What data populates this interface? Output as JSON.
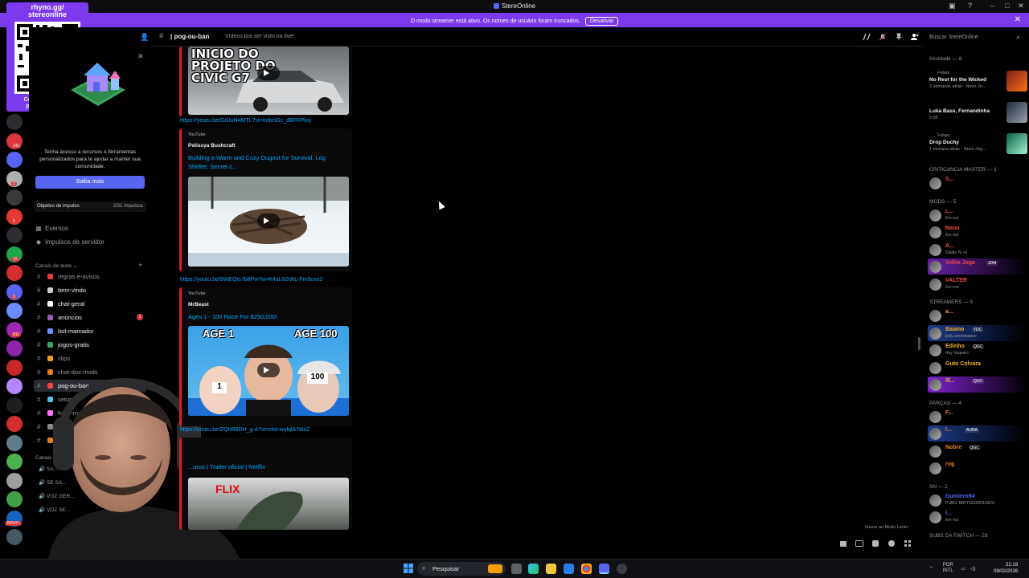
{
  "window": {
    "title": "StereOnline"
  },
  "banner": {
    "message": "O modo streamer está ativo. Os nomes de usuário foram truncados.",
    "button": "Desativar"
  },
  "overlay": {
    "handle": "rhyno.gg/\nstereonline",
    "cta": "Compre produtos personalizados!"
  },
  "server_rail": {
    "badges": [
      "241",
      "3",
      "5",
      "10",
      "3",
      "811",
      "5",
      "1",
      "63",
      "9",
      "19",
      "68"
    ],
    "new_badge": "NOVO"
  },
  "promo": {
    "text": "Tenha acesso a recursos e ferramentas personalizados para te ajudar a manter sua comunidade.",
    "button": "Saiba mais",
    "boost_label": "Objetivo de impulso",
    "boost_value": "2/31 Impulsos"
  },
  "sidebar": {
    "events": "Eventos",
    "server_boosts": "Impulsos de servidor",
    "text_category": "Canais de texto",
    "channels": [
      {
        "name": "regras-e-avisos",
        "color": "#e23b3b"
      },
      {
        "name": "bem-vindo",
        "color": "#cccccc"
      },
      {
        "name": "chat-geral",
        "color": "#ffffff"
      },
      {
        "name": "anúncios",
        "color": "#9b59b6",
        "badge": "1"
      },
      {
        "name": "bot-mamador",
        "color": "#6c8cff"
      },
      {
        "name": "jogos-gratis",
        "color": "#3ba55d"
      },
      {
        "name": "clips",
        "color": "#f0a020"
      },
      {
        "name": "chat-dos-mods",
        "color": "#e67e22"
      },
      {
        "name": "pog-ou-ban",
        "color": "#f04747"
      },
      {
        "name": "setups",
        "color": "#5bc0de"
      },
      {
        "name": "fotos-motos",
        "color": "#ff73fa"
      },
      {
        "name": "off-topic",
        "color": "#888888"
      },
      {
        "name": "eventos",
        "color": "#e67e22"
      }
    ],
    "voice_category": "Canais de voz",
    "voice": [
      "SA...",
      "SE SA...",
      "VOZ GER...",
      "VOZ SE..."
    ]
  },
  "header": {
    "channel": "| pog-ou-ban",
    "topic": "Vídeos pra ser visto na live!",
    "search_placeholder": "Buscar StereOnline"
  },
  "messages": [
    {
      "thumb_text": "INICIO DO PROJETO DO CIVIC G7",
      "link": "https://youtu.be/GdJuN4MTL?si=mtbciGc_dBFKPkxj"
    },
    {
      "provider": "YouTube",
      "author": "Polissya Bushcraft",
      "title": "Building a Warm and Cozy Dugout for Survival. Log Shelter, Secret c...",
      "link": "https://youtu.be/9WEQts7b8Pw?si=K4sL6GWL-Fm9cxo2"
    },
    {
      "provider": "YouTube",
      "author": "MrBeast",
      "title": "Ages 1 - 100 Race For $250,000!",
      "thumb_left": "AGE 1",
      "thumb_right": "AGE 100",
      "bib_left": "1",
      "bib_right": "100",
      "link": "https://youtu.be/ZQhR8DH_g-A?si=ctot-wylqlA78ui2"
    },
    {
      "title": "...uros | Trailer oficial | Netflix",
      "thumb_text": "FLIX"
    }
  ],
  "slowmode": "Imune ao Modo Lento",
  "members": {
    "activity_header": "Atividade — 8",
    "activities": [
      {
        "user": "Febas",
        "title": "No Rest for the Wicked",
        "sub": "2 semanas atrás · Novo Jo..."
      },
      {
        "user": "",
        "title": "Luka Bass, Fernandinha",
        "sub": "5:36"
      },
      {
        "user": "Febas",
        "title": "Drop Duchy",
        "sub": "1 semana atrás · Novo Jog..."
      }
    ],
    "groups": [
      {
        "header": "CRITICANCIA MASTER — 1",
        "items": [
          {
            "name": "S...",
            "color": "#f04747"
          }
        ]
      },
      {
        "header": "MODS — 5",
        "items": [
          {
            "name": "L...",
            "color": "#f04747",
            "sub": "Em voz"
          },
          {
            "name": "Nano",
            "color": "#f04747",
            "sub": "Em voz"
          },
          {
            "name": "A...",
            "color": "#f04747",
            "sub": "Diablo IV +2"
          },
          {
            "name": "Velho Joga",
            "color": "#f04747",
            "tag": "JDM",
            "highlight": "#6b21a8"
          },
          {
            "name": "VALTER",
            "color": "#f04747",
            "sub": "Em voz"
          }
        ]
      },
      {
        "header": "STREAMERS — 5",
        "items": [
          {
            "name": "a...",
            "color": "#f0b232"
          },
          {
            "name": "Baiano",
            "color": "#f0b232",
            "tag": "TDC",
            "sub": "kick.com/obaiano",
            "highlight": "#1e3a8a"
          },
          {
            "name": "Edinho",
            "color": "#f0b232",
            "tag": "QGC",
            "sub": "Rey Vaquero"
          },
          {
            "name": "Guto Colvara",
            "color": "#f0b232"
          },
          {
            "name": "Ill...",
            "color": "#f0b232",
            "tag": "QGC",
            "highlight": "#7e22ce"
          }
        ]
      },
      {
        "header": "PARÇAS — 4",
        "items": [
          {
            "name": "F...",
            "color": "#e67e22"
          },
          {
            "name": "l...",
            "color": "#e67e22",
            "tag": "AURA",
            "highlight": "#1e3a8a"
          },
          {
            "name": "Nobre",
            "color": "#e67e22",
            "tag": "QGC"
          },
          {
            "name": "rog",
            "color": "#e67e22"
          }
        ]
      },
      {
        "header": "SN — 2",
        "items": [
          {
            "name": "Gumiero94",
            "color": "#5865f2",
            "sub": "PUBG: BATTLEGROUNDS"
          },
          {
            "name": "l...",
            "color": "#5865f2",
            "sub": "Em voz"
          }
        ]
      },
      {
        "header": "SUBS DA TWITCH — 23",
        "items": []
      }
    ]
  },
  "taskbar": {
    "search": "Pesquisar",
    "lang": "POR\nINTL",
    "time": "22:19",
    "date": "09/02/2026"
  }
}
